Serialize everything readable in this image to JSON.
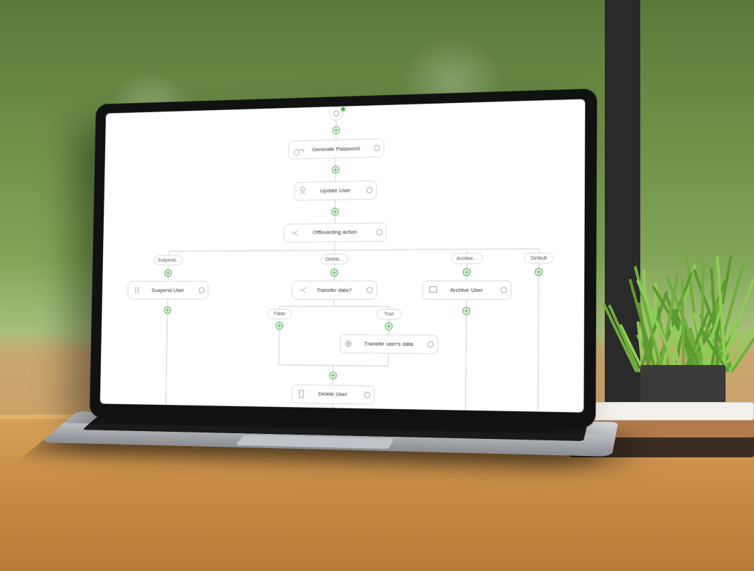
{
  "workflow": {
    "start_icon": "user-icon",
    "nodes": {
      "generate_password": {
        "label": "Generate Password",
        "icon": "key-icon"
      },
      "update_user": {
        "label": "Update User",
        "icon": "user-edit-icon"
      },
      "offboarding_action": {
        "label": "Offboarding action",
        "icon": "branch-icon"
      },
      "suspend_user": {
        "label": "Suspend User",
        "icon": "pause-user-icon"
      },
      "transfer_data_q": {
        "label": "Transfer data?",
        "icon": "branch-icon"
      },
      "archive_user": {
        "label": "Archive User",
        "icon": "archive-icon"
      },
      "transfer_users_data": {
        "label": "Transfer user's data",
        "icon": "transfer-icon"
      },
      "delete_user": {
        "label": "Delete User",
        "icon": "trash-icon"
      }
    },
    "branch_labels": {
      "suspend": "Suspend...",
      "delete": "Delete...",
      "archive": "Archive...",
      "default": "Default",
      "false": "False",
      "true": "True"
    }
  }
}
